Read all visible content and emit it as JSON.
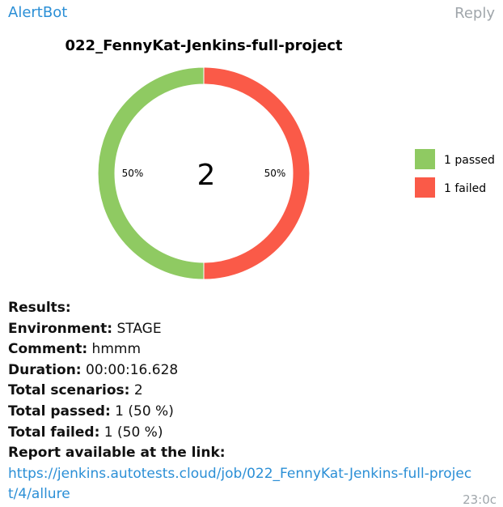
{
  "message": {
    "sender": "AlertBot",
    "reply_label": "Reply",
    "time": "23:0ϲ"
  },
  "chart_data": {
    "type": "pie",
    "title": "022_FennyKat-Jenkins-full-project",
    "center_label": "2",
    "slices": [
      {
        "label": "1 passed",
        "value": 1,
        "percent_label": "50%",
        "color": "#8fca62"
      },
      {
        "label": "1 failed",
        "value": 1,
        "percent_label": "50%",
        "color": "#fa5a48"
      }
    ],
    "legend_position": "right"
  },
  "results": {
    "heading": "Results:",
    "environment_key": "Environment:",
    "environment_value": " STAGE",
    "comment_key": "Comment:",
    "comment_value": " hmmm",
    "duration_key": "Duration:",
    "duration_value": " 00:00:16.628",
    "total_scenarios_key": "Total scenarios:",
    "total_scenarios_value": " 2",
    "total_passed_key": "Total passed:",
    "total_passed_value": " 1 (50 %)",
    "total_failed_key": "Total failed:",
    "total_failed_value": " 1 (50 %)",
    "report_label": "Report available at the link:",
    "report_link": "https://jenkins.autotests.cloud/job/022_FennyKat-Jenkins-full-project/4/allure"
  }
}
